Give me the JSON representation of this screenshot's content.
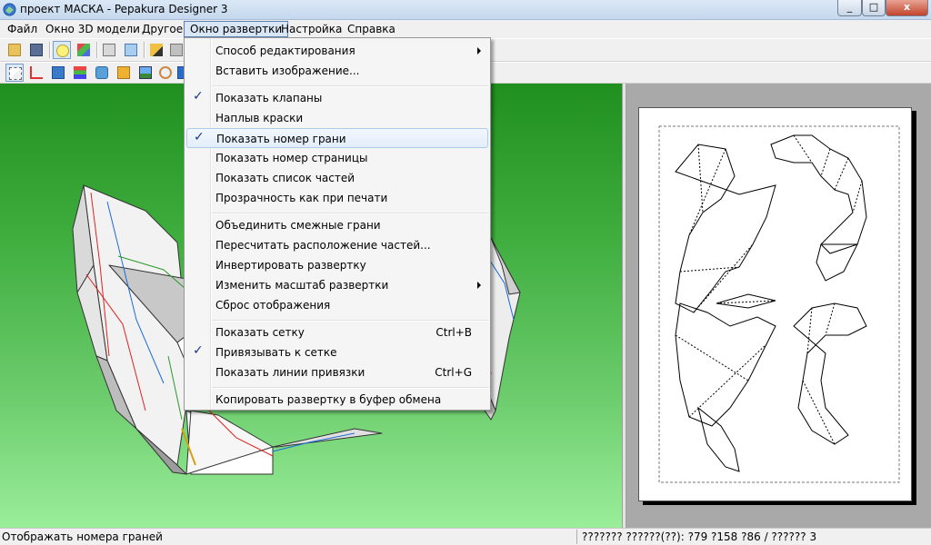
{
  "window": {
    "title": "проект МАСКА - Pepakura Designer 3",
    "close_glyph": "x",
    "maximize_glyph": "□",
    "minimize_glyph": "_"
  },
  "menubar": {
    "items": [
      {
        "label": "Файл"
      },
      {
        "label": "Окно 3D модели"
      },
      {
        "label": "Другое"
      },
      {
        "label": "Окно развертки",
        "active": true
      },
      {
        "label": "Настройка"
      },
      {
        "label": "Справка"
      }
    ]
  },
  "dropdown": {
    "items": [
      {
        "label": "Способ редактирования",
        "submenu": true
      },
      {
        "label": "Вставить изображение..."
      },
      {
        "label": "Показать клапаны",
        "checked": true
      },
      {
        "label": "Наплыв краски"
      },
      {
        "label": "Показать номер грани",
        "checked": true,
        "highlighted": true
      },
      {
        "label": "Показать номер страницы"
      },
      {
        "label": "Показать список частей"
      },
      {
        "label": "Прозрачность как при печати"
      },
      {
        "label": "Объединить смежные грани"
      },
      {
        "label": "Пересчитать расположение частей..."
      },
      {
        "label": "Инвертировать развертку"
      },
      {
        "label": "Изменить масштаб развертки",
        "submenu": true
      },
      {
        "label": "Сброс отображения"
      },
      {
        "label": "Показать сетку",
        "shortcut": "Ctrl+B"
      },
      {
        "label": "Привязывать к сетке",
        "checked": true
      },
      {
        "label": "Показать линии привязки",
        "shortcut": "Ctrl+G"
      },
      {
        "label": "Копировать развертку в буфер обмена"
      }
    ],
    "check_glyph": "✓"
  },
  "toolbar1": {
    "icons": [
      "open-icon",
      "save-icon",
      "lightbulb-icon",
      "cube-color-icon",
      "cube-icon",
      "cube-blue-icon",
      "pencil-icon",
      "bin-icon"
    ]
  },
  "toolbar2": {
    "icons": [
      "select-arrow-icon",
      "edge-icon",
      "ruler-icon",
      "paint-icon",
      "tube-icon",
      "text-icon",
      "image-icon",
      "rotate-icon",
      "move-icon"
    ]
  },
  "statusbar": {
    "left": "Отображать номера граней",
    "right": "??????? ??????(??): ?79 ?158 ?86 / ?????? 3"
  },
  "colors": {
    "accent": "#5c80b0",
    "view_green_top": "#1f8f1f",
    "view_green_bottom": "#9aee9a",
    "check": "#1a3a8a"
  }
}
